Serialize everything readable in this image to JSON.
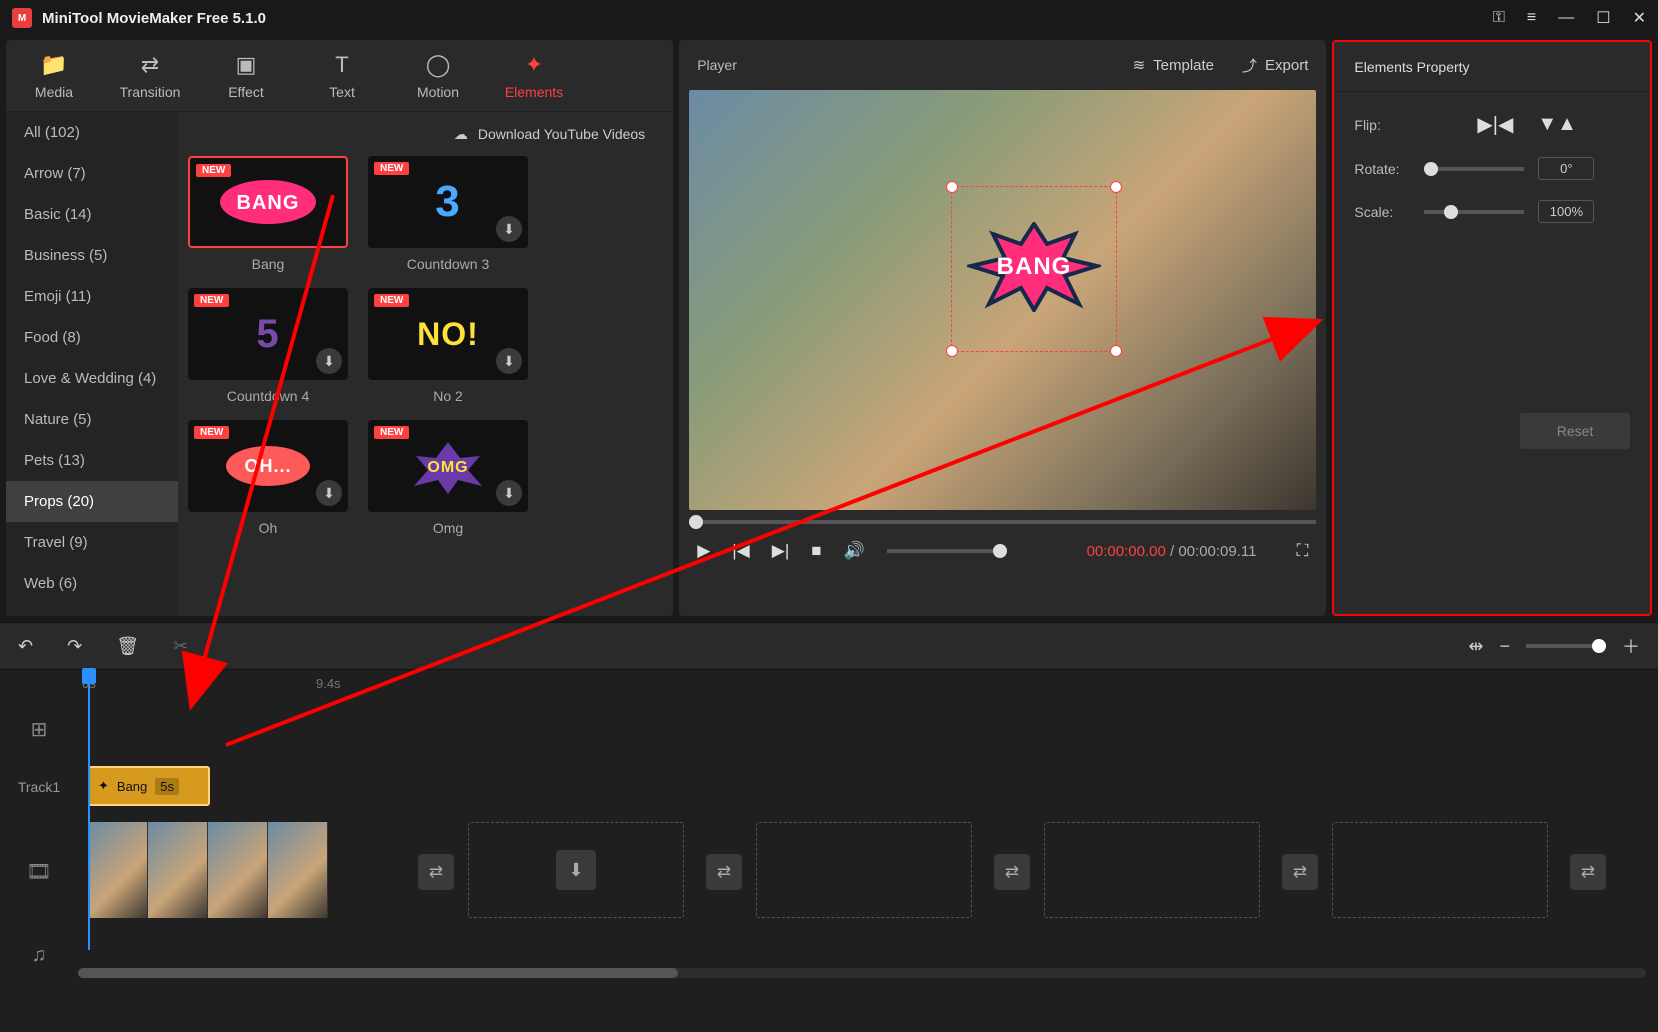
{
  "app": {
    "title": "MiniTool MovieMaker Free 5.1.0"
  },
  "toolbar": {
    "tabs": [
      {
        "label": "Media"
      },
      {
        "label": "Transition"
      },
      {
        "label": "Effect"
      },
      {
        "label": "Text"
      },
      {
        "label": "Motion"
      },
      {
        "label": "Elements"
      }
    ],
    "download_label": "Download YouTube Videos"
  },
  "categories": [
    {
      "label": "All (102)"
    },
    {
      "label": "Arrow (7)"
    },
    {
      "label": "Basic (14)"
    },
    {
      "label": "Business (5)"
    },
    {
      "label": "Emoji (11)"
    },
    {
      "label": "Food (8)"
    },
    {
      "label": "Love & Wedding (4)"
    },
    {
      "label": "Nature (5)"
    },
    {
      "label": "Pets (13)"
    },
    {
      "label": "Props (20)",
      "active": true
    },
    {
      "label": "Travel (9)"
    },
    {
      "label": "Web (6)"
    }
  ],
  "elements": [
    {
      "label": "Bang",
      "badge": "NEW",
      "selected": true
    },
    {
      "label": "Countdown 3",
      "badge": "NEW"
    },
    {
      "label": "Countdown 4",
      "badge": "NEW"
    },
    {
      "label": "No 2",
      "badge": "NEW"
    },
    {
      "label": "Oh",
      "badge": "NEW"
    },
    {
      "label": "Omg",
      "badge": "NEW"
    }
  ],
  "player": {
    "title": "Player",
    "template_label": "Template",
    "export_label": "Export",
    "time_current": "00:00:00.00",
    "time_sep": " / ",
    "time_total": "00:00:09.11"
  },
  "properties": {
    "title": "Elements Property",
    "flip_label": "Flip:",
    "rotate_label": "Rotate:",
    "rotate_value": "0°",
    "scale_label": "Scale:",
    "scale_value": "100%",
    "reset_label": "Reset"
  },
  "timeline": {
    "ruler": {
      "t0": "0s",
      "t1": "9.4s"
    },
    "track1_label": "Track1",
    "clip_name": "Bang",
    "clip_duration": "5s"
  },
  "badges": {
    "new": "NEW"
  }
}
